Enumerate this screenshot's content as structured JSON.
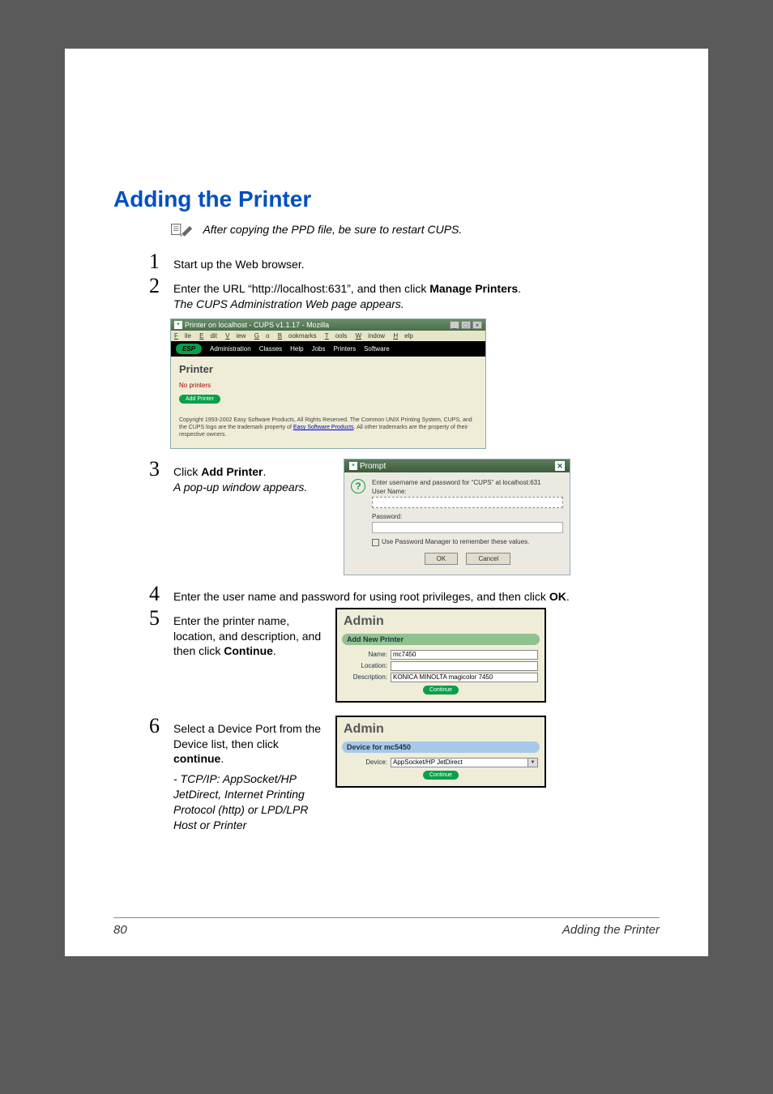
{
  "heading": "Adding the Printer",
  "note": {
    "text": "After copying the PPD file, be sure to restart CUPS."
  },
  "steps": {
    "s1": {
      "num": "1",
      "text": "Start up the Web browser."
    },
    "s2": {
      "num": "2",
      "text_prefix": "Enter the URL “http://localhost:631”, and then click ",
      "text_bold": "Manage Printers",
      "text_suffix": ".",
      "sub_italic": "The CUPS Administration Web page appears."
    },
    "s3": {
      "num": "3",
      "text_prefix": "Click ",
      "text_bold": "Add Printer",
      "text_suffix": ".",
      "sub_italic": "A pop-up window appears."
    },
    "s4": {
      "num": "4",
      "text_prefix": "Enter the user name and password for using root privileges, and then click ",
      "text_bold": "OK",
      "text_suffix": "."
    },
    "s5": {
      "num": "5",
      "text_prefix": "Enter the printer name, location, and description, and then click ",
      "text_bold": "Continue",
      "text_suffix": "."
    },
    "s6": {
      "num": "6",
      "text_prefix": "Select a Device Port from the Device list, then click ",
      "text_bold": "continue",
      "text_suffix": ".",
      "sub_italic": "- TCP/IP: AppSocket/HP JetDirect, Internet Printing Protocol (http) or LPD/LPR Host or Printer"
    }
  },
  "shot1": {
    "title": "Printer on localhost - CUPS v1.1.17 - Mozilla",
    "menu": {
      "file": "File",
      "edit": "Edit",
      "view": "View",
      "go": "Go",
      "bookmarks": "Bookmarks",
      "tools": "Tools",
      "window": "Window",
      "help": "Help"
    },
    "nav": {
      "esp": "ESP",
      "admin": "Administration",
      "classes": "Classes",
      "help": "Help",
      "jobs": "Jobs",
      "printers": "Printers",
      "software": "Software"
    },
    "h": "Printer",
    "noprt": "No printers",
    "addbtn": "Add Printer",
    "copy_a": "Copyright 1993-2002 Easy Software Products, All Rights Reserved. The Common UNIX Printing System, CUPS, and the CUPS logo are the trademark property of ",
    "copy_link": "Easy Software Products",
    "copy_b": ". All other trademarks are the property of their respective owners."
  },
  "prompt": {
    "title": "Prompt",
    "msg": "Enter username and password for “CUPS” at localhost:631",
    "user_label": "User Name:",
    "pass_label": "Password:",
    "chk_label": "Use Password Manager to remember these values.",
    "ok": "OK",
    "cancel": "Cancel"
  },
  "admin1": {
    "h": "Admin",
    "sec": "Add New Printer",
    "name_lab": "Name:",
    "name_val": "mc7450",
    "loc_lab": "Location:",
    "loc_val": "",
    "desc_lab": "Description:",
    "desc_val": "KONICA MINOLTA magicolor 7450",
    "cont": "Continue"
  },
  "admin2": {
    "h": "Admin",
    "sec": "Device for mc5450",
    "dev_lab": "Device:",
    "dev_val": "AppSocket/HP JetDirect",
    "cont": "Continue"
  },
  "footer": {
    "page": "80",
    "title": "Adding the Printer"
  }
}
